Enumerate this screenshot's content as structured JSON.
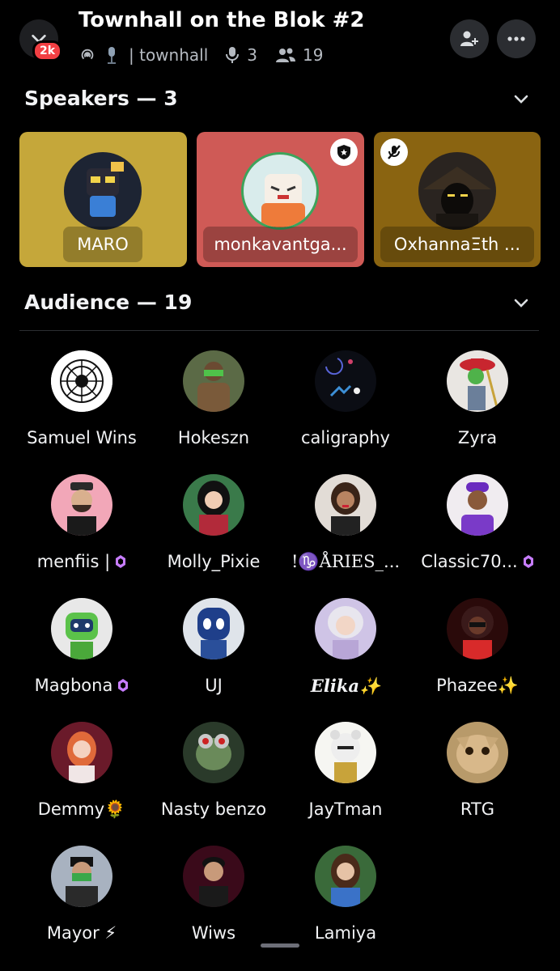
{
  "header": {
    "title": "Townhall on the Blok #2",
    "badge": "2k",
    "channel": "| townhall",
    "speaker_count": "3",
    "listener_count": "19"
  },
  "sections": {
    "speakers_title": "Speakers — 3",
    "audience_title": "Audience — 19"
  },
  "speakers": [
    {
      "name": "MARO",
      "card_color": "#c5a73a"
    },
    {
      "name": "monkavantga...",
      "card_color": "#cf5a56"
    },
    {
      "name": "OxhannaΞth ...",
      "card_color": "#8a6411"
    }
  ],
  "audience": [
    {
      "name": "Samuel Wins"
    },
    {
      "name": "Hokeszn"
    },
    {
      "name": "caligraphy"
    },
    {
      "name": "Zyra"
    },
    {
      "name": "menfiis |"
    },
    {
      "name": "Molly_Pixie"
    },
    {
      "name": "!♑ÅRIES_..."
    },
    {
      "name": "Classic70..."
    },
    {
      "name": "Magbona"
    },
    {
      "name": "UJ"
    },
    {
      "name": "Elika✨"
    },
    {
      "name": "Phazee✨"
    },
    {
      "name": "Demmy🌻"
    },
    {
      "name": "Nasty benzo"
    },
    {
      "name": "JayTman"
    },
    {
      "name": "RTG"
    },
    {
      "name": "Mayor ⚡"
    },
    {
      "name": "Wiws"
    },
    {
      "name": "Lamiya"
    }
  ],
  "colors": {
    "background": "#000000",
    "nitro_badge": "#c77dff",
    "badge_red": "#f23f43"
  }
}
